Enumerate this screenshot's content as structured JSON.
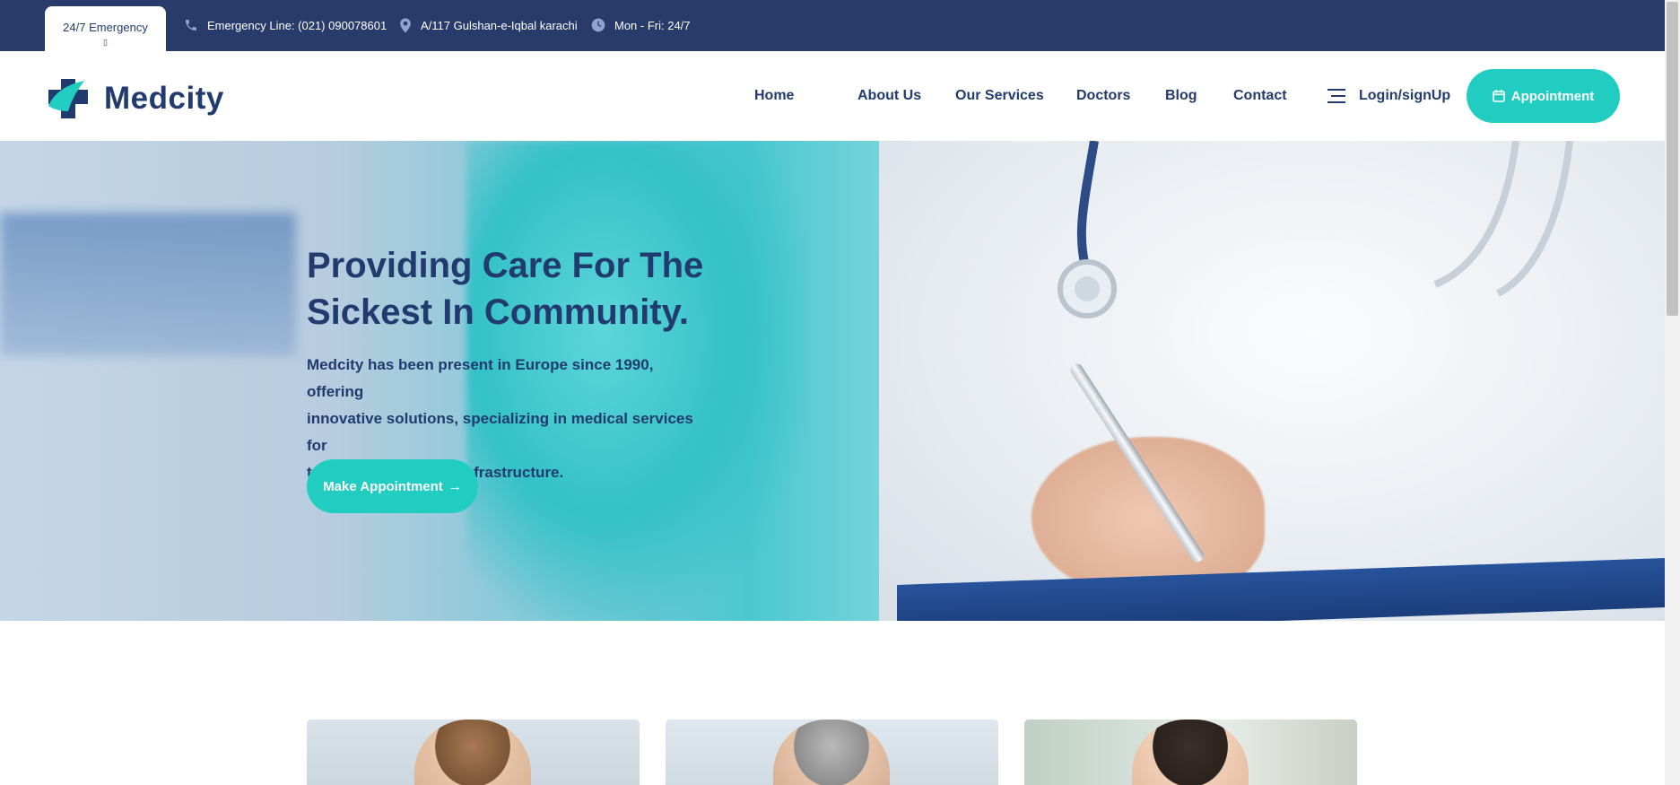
{
  "topbar": {
    "emergency_label": "24/7 Emergency",
    "emergency_glyph": "▯",
    "phone": "Emergency Line: (021) 090078601",
    "address": "A/117 Gulshan-e-Iqbal karachi",
    "hours": "Mon - Fri: 24/7"
  },
  "header": {
    "logo_text": "Medcity",
    "nav": [
      "Home",
      "About Us",
      "Our Services",
      "Doctors",
      "Blog",
      "Contact"
    ],
    "login_label": "Login/signUp",
    "appointment_label": "Appointment"
  },
  "hero": {
    "title_line1": "Providing Care For The",
    "title_line2": "Sickest In Community.",
    "text_line1": "Medcity has been present in Europe since 1990, offering",
    "text_line2": "innovative solutions, specializing in medical services for",
    "text_line3": "treatment of medical infrastructure.",
    "button_label": "Make Appointment",
    "button_arrow": "→"
  },
  "colors": {
    "navy": "#213b6e",
    "topbar": "#283b6a",
    "accent": "#21cdc0"
  },
  "icons": {
    "phone": "phone-icon",
    "location": "location-pin-icon",
    "clock": "clock-icon",
    "menu": "menu-lines-icon",
    "calendar": "calendar-icon",
    "logo": "medical-cross-logo-icon"
  }
}
